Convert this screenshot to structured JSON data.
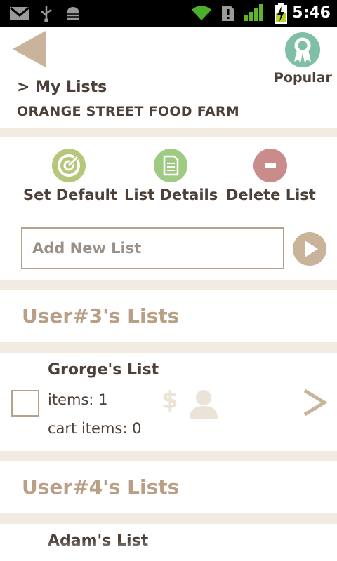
{
  "status_bar": {
    "time": "5:46",
    "icons": [
      "gmail-icon",
      "usb-icon",
      "android-debug-icon",
      "wifi-icon",
      "alert-icon",
      "signal-icon",
      "battery-charging-icon"
    ]
  },
  "header": {
    "back_icon": "back-arrow-icon",
    "popular_label": "Popular",
    "breadcrumb": "> My Lists",
    "store_name": "ORANGE STREET FOOD FARM"
  },
  "actions": {
    "set_default": {
      "label": "Set Default",
      "color": "#b6c67a"
    },
    "list_details": {
      "label": "List Details",
      "color": "#9fca84"
    },
    "delete_list": {
      "label": "Delete List",
      "color": "#c98c8b"
    }
  },
  "add_list": {
    "placeholder": "Add New List"
  },
  "sections": [
    {
      "title": "User#3's Lists",
      "lists": [
        {
          "name": "Grorge's List",
          "items": "items: 1",
          "cart_items": "cart items: 0",
          "price_icon": "$"
        }
      ]
    },
    {
      "title": "User#4's Lists",
      "lists": [
        {
          "name": "Adam's List"
        }
      ]
    }
  ],
  "colors": {
    "accent_tan": "#b89f85",
    "text_dark": "#4c4038",
    "background": "#f1ebe2",
    "popular_green": "#7fbfa5"
  }
}
